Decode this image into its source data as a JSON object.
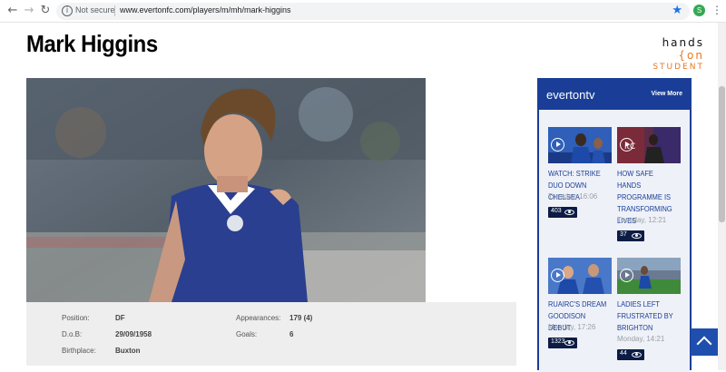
{
  "browser": {
    "not_secure": "Not secure",
    "url": "www.evertonfc.com/players/m/mh/mark-higgins",
    "profile_initial": "S"
  },
  "page": {
    "title": "Mark Higgins",
    "logo_top": "hands",
    "logo_top_bracket": "{on",
    "logo_bottom": "STUDENT"
  },
  "player": {
    "position_label": "Position:",
    "position_value": "DF",
    "dob_label": "D.o.B:",
    "dob_value": "29/09/1958",
    "birthplace_label": "Birthplace:",
    "birthplace_value": "Buxton",
    "appearances_label": "Appearances:",
    "appearances_value": "179 (4)",
    "goals_label": "Goals:",
    "goals_value": "6"
  },
  "everton_tv": {
    "title": "evertontv",
    "view_more": "View More",
    "videos": [
      {
        "title": "WATCH: STRIKE DUO DOWN CHELSEA",
        "time": "Tuesday, 16:06",
        "views": "403"
      },
      {
        "title": "HOW SAFE HANDS PROGRAMME IS TRANSFORMING LIVES",
        "time": "Tuesday, 12:21",
        "views": "37"
      },
      {
        "title": "RUAIRC'S DREAM GOODISON DEBUT",
        "time": "Monday, 17:26",
        "views": "1323"
      },
      {
        "title": "LADIES LEFT FRUSTRATED BY BRIGHTON",
        "time": "Monday, 14:21",
        "views": "44"
      }
    ]
  },
  "colors": {
    "everton_blue": "#1a3e98",
    "accent_orange": "#e87722",
    "info_bg": "#eeeeee"
  }
}
